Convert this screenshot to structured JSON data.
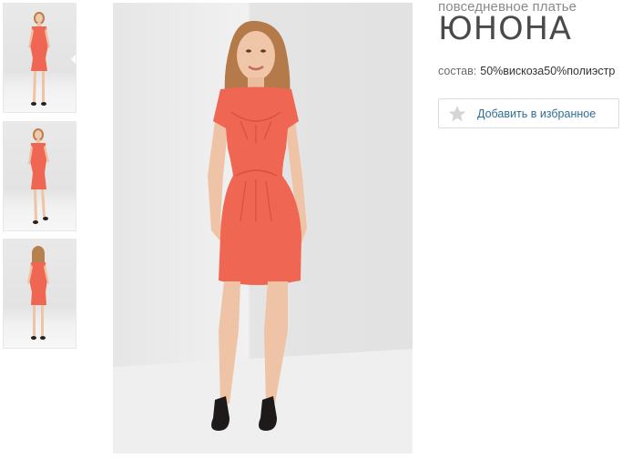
{
  "product": {
    "subtitle": "повседневное платье",
    "title": "ЮНОНА",
    "composition_label": "состав:",
    "composition_value": "50%вискоза50%полиэстр"
  },
  "favorite_button": {
    "label": "Добавить в избранное",
    "icon": "star-icon"
  },
  "gallery": {
    "thumbnails": [
      {
        "view": "front",
        "active": true
      },
      {
        "view": "three-quarter",
        "active": false
      },
      {
        "view": "back",
        "active": false
      }
    ]
  },
  "colors": {
    "dress": "#ef6653",
    "star": "#d5d5d5",
    "link": "#2e6f97",
    "title": "#4a4a4a"
  }
}
